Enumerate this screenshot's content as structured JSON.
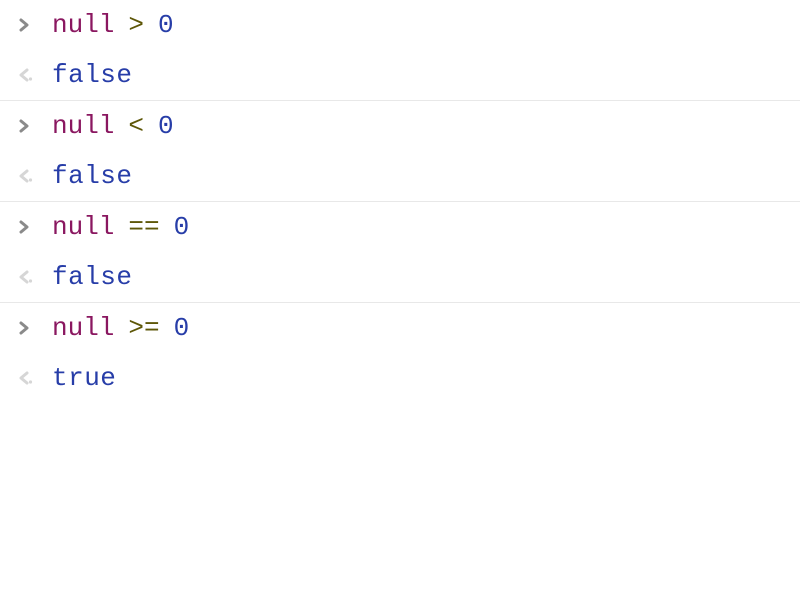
{
  "entries": [
    {
      "input": {
        "keyword": "null",
        "operator": ">",
        "number": "0"
      },
      "output": "false"
    },
    {
      "input": {
        "keyword": "null",
        "operator": "<",
        "number": "0"
      },
      "output": "false"
    },
    {
      "input": {
        "keyword": "null",
        "operator": "==",
        "number": "0"
      },
      "output": "false"
    },
    {
      "input": {
        "keyword": "null",
        "operator": ">=",
        "number": "0"
      },
      "output": "true"
    }
  ]
}
